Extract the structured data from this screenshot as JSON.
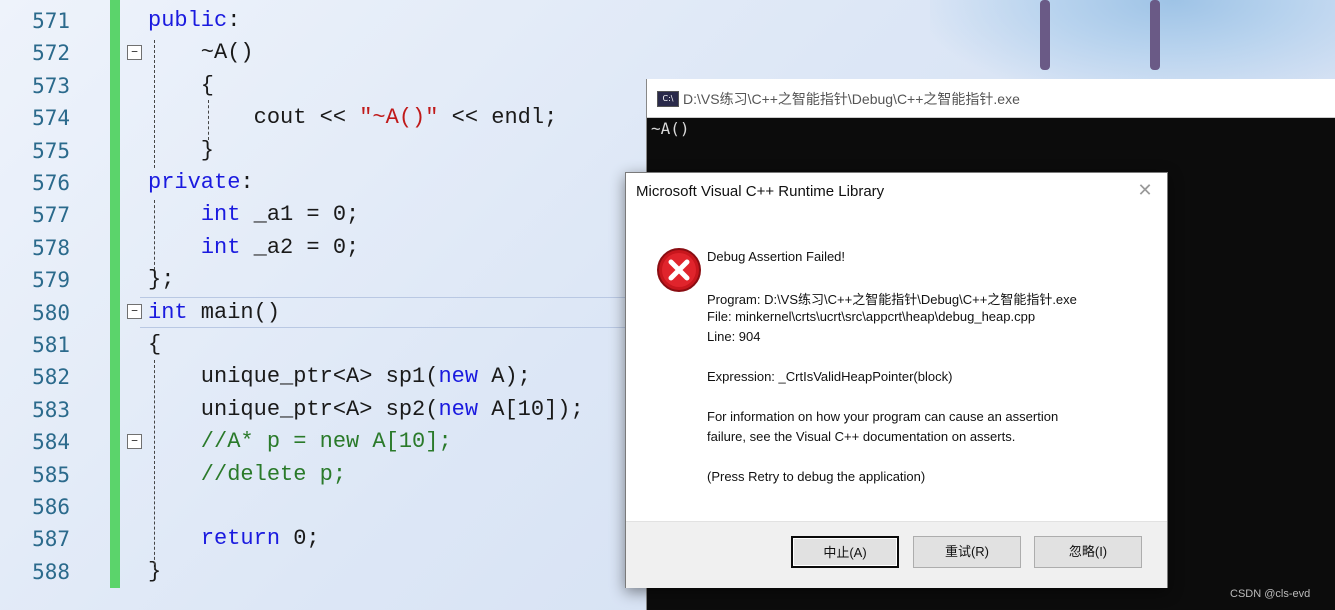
{
  "editor": {
    "lines": [
      {
        "no": "571",
        "parts": [
          {
            "t": "public",
            "c": "kw"
          },
          {
            "t": ":",
            "c": ""
          }
        ]
      },
      {
        "no": "572",
        "parts": [
          {
            "t": "    ~A()",
            "c": ""
          }
        ]
      },
      {
        "no": "573",
        "parts": [
          {
            "t": "    {",
            "c": ""
          }
        ]
      },
      {
        "no": "574",
        "parts": [
          {
            "t": "        cout << ",
            "c": ""
          },
          {
            "t": "\"~A()\"",
            "c": "str"
          },
          {
            "t": " << endl;",
            "c": ""
          }
        ]
      },
      {
        "no": "575",
        "parts": [
          {
            "t": "    }",
            "c": ""
          }
        ]
      },
      {
        "no": "576",
        "parts": [
          {
            "t": "private",
            "c": "kw"
          },
          {
            "t": ":",
            "c": ""
          }
        ]
      },
      {
        "no": "577",
        "parts": [
          {
            "t": "    ",
            "c": ""
          },
          {
            "t": "int",
            "c": "kw"
          },
          {
            "t": " _a1 = 0;",
            "c": ""
          }
        ]
      },
      {
        "no": "578",
        "parts": [
          {
            "t": "    ",
            "c": ""
          },
          {
            "t": "int",
            "c": "kw"
          },
          {
            "t": " _a2 = 0;",
            "c": ""
          }
        ]
      },
      {
        "no": "579",
        "parts": [
          {
            "t": "};",
            "c": ""
          }
        ]
      },
      {
        "no": "580",
        "parts": [
          {
            "t": "int",
            "c": "kw"
          },
          {
            "t": " main()",
            "c": ""
          }
        ]
      },
      {
        "no": "581",
        "parts": [
          {
            "t": "{",
            "c": ""
          }
        ]
      },
      {
        "no": "582",
        "parts": [
          {
            "t": "    unique_ptr<A> sp1(",
            "c": ""
          },
          {
            "t": "new",
            "c": "kw"
          },
          {
            "t": " A);",
            "c": ""
          }
        ]
      },
      {
        "no": "583",
        "parts": [
          {
            "t": "    unique_ptr<A> sp2(",
            "c": ""
          },
          {
            "t": "new",
            "c": "kw"
          },
          {
            "t": " A[10]);",
            "c": ""
          }
        ]
      },
      {
        "no": "584",
        "parts": [
          {
            "t": "    //A* p = new A[10];",
            "c": "cm"
          }
        ]
      },
      {
        "no": "585",
        "parts": [
          {
            "t": "    //delete p;",
            "c": "cm"
          }
        ]
      },
      {
        "no": "586",
        "parts": [
          {
            "t": "",
            "c": ""
          }
        ]
      },
      {
        "no": "587",
        "parts": [
          {
            "t": "    ",
            "c": ""
          },
          {
            "t": "return",
            "c": "kw"
          },
          {
            "t": " 0;",
            "c": ""
          }
        ]
      },
      {
        "no": "588",
        "parts": [
          {
            "t": "}",
            "c": ""
          }
        ]
      }
    ],
    "fold_marker": "−"
  },
  "console": {
    "icon_label": "C:\\",
    "title": "D:\\VS练习\\C++之智能指针\\Debug\\C++之智能指针.exe",
    "output": "~A()"
  },
  "dialog": {
    "title": "Microsoft Visual C++ Runtime Library",
    "close_glyph": "✕",
    "heading": "Debug Assertion Failed!",
    "program": "Program: D:\\VS练习\\C++之智能指针\\Debug\\C++之智能指针.exe",
    "file": "File: minkernel\\crts\\ucrt\\src\\appcrt\\heap\\debug_heap.cpp",
    "line": "Line: 904",
    "expression": "Expression: _CrtIsValidHeapPointer(block)",
    "info1": "For information on how your program can cause an assertion",
    "info2": "failure, see the Visual C++ documentation on asserts.",
    "press": "(Press Retry to debug the application)",
    "buttons": {
      "abort": "中止(A)",
      "retry": "重试(R)",
      "ignore": "忽略(I)"
    }
  },
  "watermark": "CSDN @cls-evd"
}
